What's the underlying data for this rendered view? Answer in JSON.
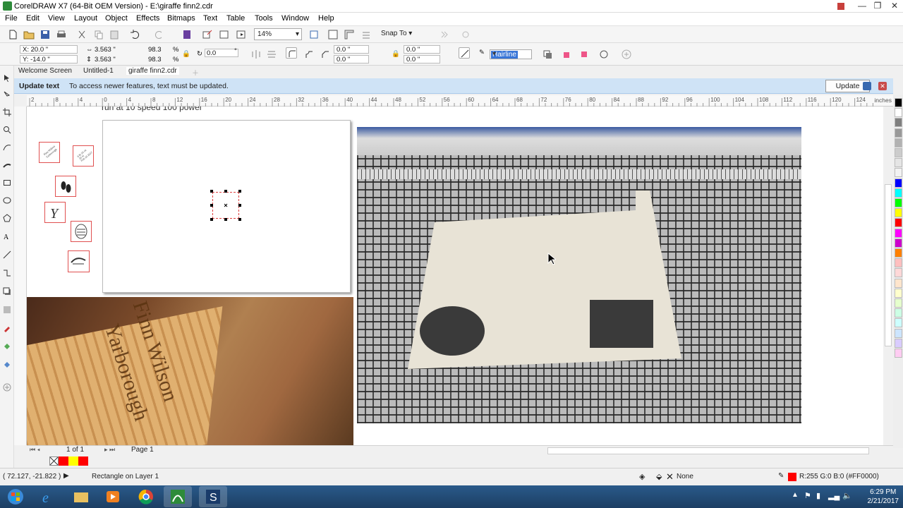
{
  "window": {
    "title": "CorelDRAW X7 (64-Bit OEM Version) - E:\\giraffe finn2.cdr"
  },
  "menu": [
    "File",
    "Edit",
    "View",
    "Layout",
    "Object",
    "Effects",
    "Bitmaps",
    "Text",
    "Table",
    "Tools",
    "Window",
    "Help"
  ],
  "toolbar": {
    "zoom": "14%",
    "snap_to": "Snap To"
  },
  "property_bar": {
    "x": "X: 20.0 \"",
    "y": "Y: -14.0 \"",
    "width": "3.563 \"",
    "height": "3.563 \"",
    "scale_x": "98.3",
    "scale_y": "98.3",
    "pct": "%",
    "pct2": "%",
    "rotation": "0.0",
    "rotation_unit": "°",
    "corner_1": "0.0 \"",
    "corner_2": "0.0 \"",
    "corner_3": "0.0 \"",
    "corner_4": "0.0 \"",
    "outline_width": "Hairline"
  },
  "doc_tabs": [
    "Welcome Screen",
    "Untitled-1",
    "giraffe finn2.cdr"
  ],
  "notification": {
    "title": "Update text",
    "message": "To access newer features, text must be updated.",
    "button": "Update"
  },
  "ruler": {
    "unit": "inches",
    "labels": [
      "2",
      "8",
      "4",
      "0",
      "4",
      "8",
      "12",
      "16",
      "20",
      "24",
      "28",
      "32",
      "36",
      "40",
      "44",
      "48",
      "52",
      "56",
      "60",
      "64",
      "68",
      "72",
      "76",
      "80",
      "84",
      "88",
      "92",
      "96",
      "100",
      "104",
      "108",
      "112",
      "116",
      "120",
      "124"
    ]
  },
  "canvas": {
    "top_text": "run at 10 speed 100 power"
  },
  "page_nav": {
    "page_count": "1 of 1",
    "page_tab": "Page 1"
  },
  "status": {
    "coords": "( 72.127, -21.822 )",
    "info": "Rectangle on Layer 1",
    "fill": "None",
    "outline": "R:255 G:0 B:0 (#FF0000)"
  },
  "colors": {
    "accent": "#3875d7",
    "notif_bg": "#cfe3f6",
    "outline_red": "#ff0000"
  },
  "palette": [
    "#000000",
    "#ffffff",
    "#7f7f7f",
    "#999999",
    "#b2b2b2",
    "#cccccc",
    "#e5e5e5",
    "#f2f2f2",
    "#0000ff",
    "#00ffff",
    "#00ff00",
    "#ffff00",
    "#ff0000",
    "#ff00ff",
    "#cc00cc",
    "#ff8000",
    "#ffbfbf",
    "#ffd8d8",
    "#ffe5cc",
    "#ffffcc",
    "#e5ffcc",
    "#ccffe5",
    "#ccffff",
    "#cce5ff",
    "#d9ccff",
    "#ffccf2"
  ],
  "taskbar": {
    "time": "6:29 PM",
    "date": "2/21/2017"
  }
}
